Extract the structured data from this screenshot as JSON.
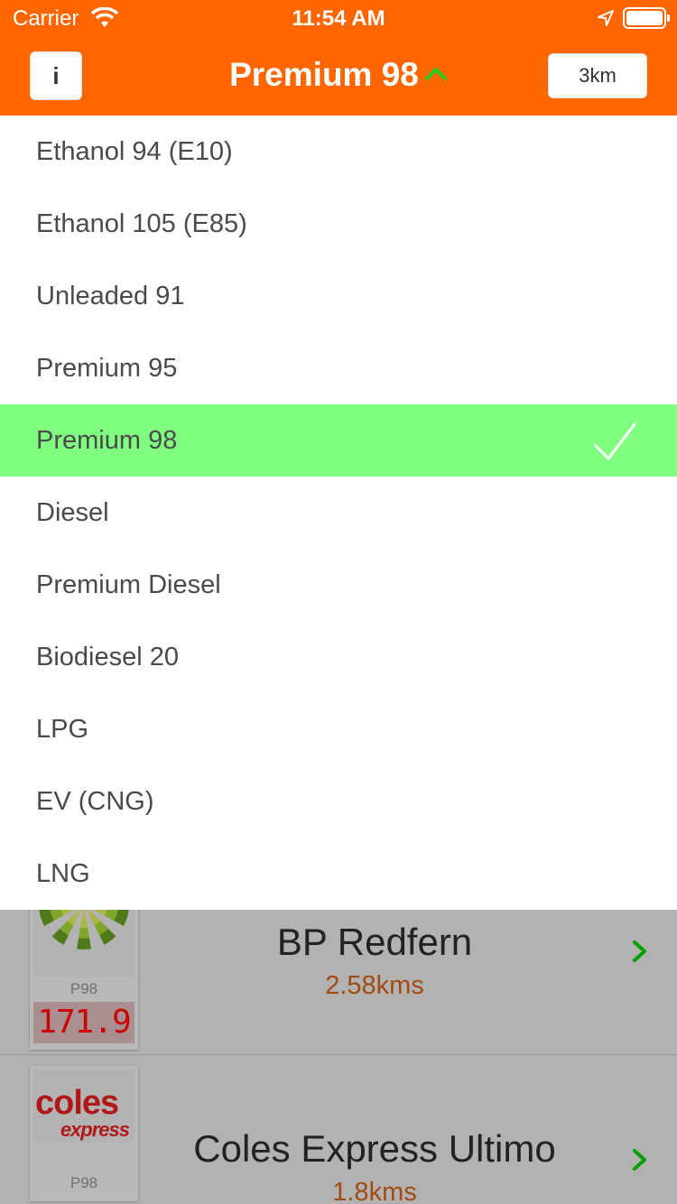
{
  "status_bar": {
    "carrier": "Carrier",
    "time": "11:54 AM"
  },
  "nav": {
    "info_label": "i",
    "title": "Premium 98",
    "distance_label": "3km"
  },
  "fuel_list": [
    {
      "label": "Ethanol 94 (E10)",
      "selected": false
    },
    {
      "label": "Ethanol 105 (E85)",
      "selected": false
    },
    {
      "label": "Unleaded 91",
      "selected": false
    },
    {
      "label": "Premium 95",
      "selected": false
    },
    {
      "label": "Premium 98",
      "selected": true
    },
    {
      "label": "Diesel",
      "selected": false
    },
    {
      "label": "Premium Diesel",
      "selected": false
    },
    {
      "label": "Biodiesel 20",
      "selected": false
    },
    {
      "label": "LPG",
      "selected": false
    },
    {
      "label": "EV (CNG)",
      "selected": false
    },
    {
      "label": "LNG",
      "selected": false
    }
  ],
  "stations": [
    {
      "name": "BP Redfern",
      "distance": "2.58kms",
      "fuel_code": "P98",
      "price": "171.9"
    },
    {
      "name": "Coles Express Ultimo",
      "distance": "1.8kms",
      "fuel_code": "P98",
      "price": ""
    }
  ],
  "colors": {
    "nav_bg": "#ff6600",
    "selected_row": "#80ff80",
    "chevron": "#00a000"
  }
}
